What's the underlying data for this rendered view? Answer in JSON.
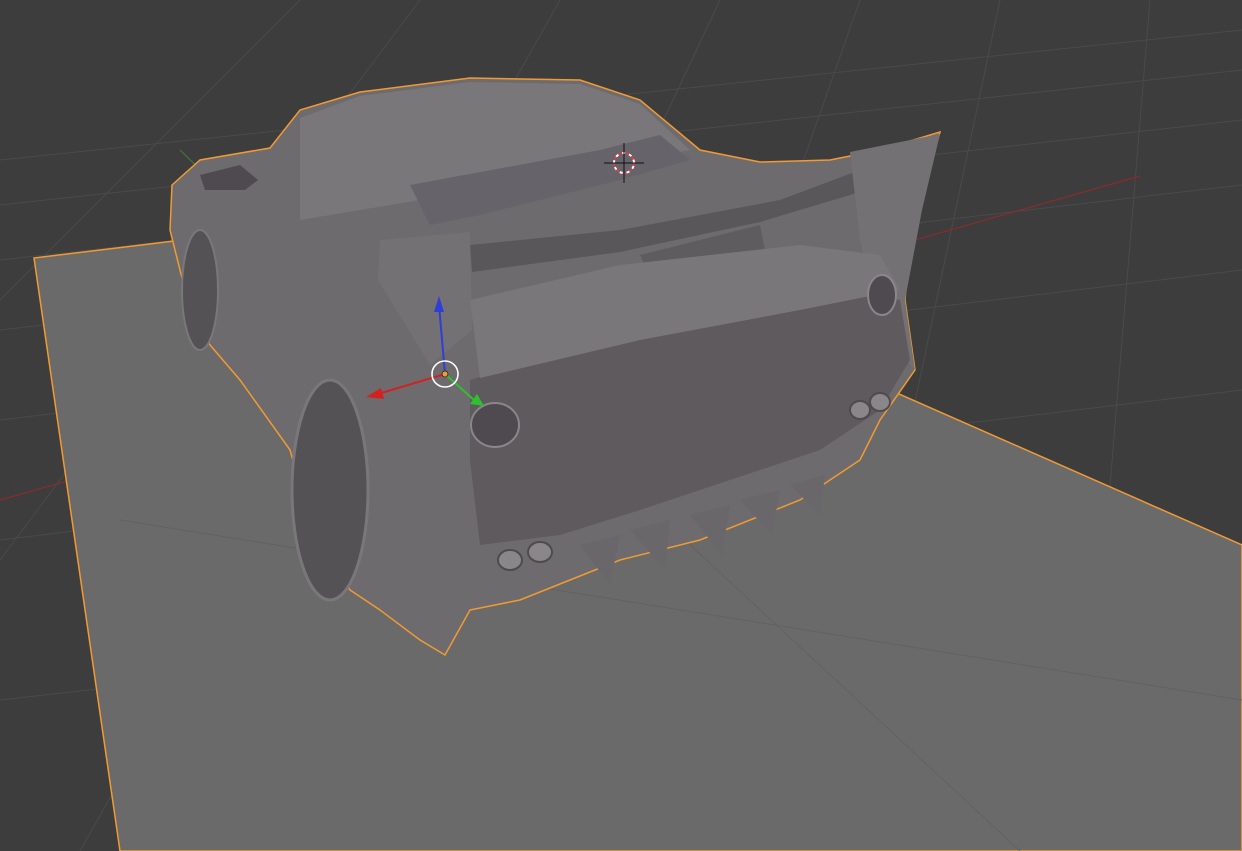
{
  "viewport": {
    "background": "#3d3d3d",
    "grid_color": "#4a4a4a",
    "x_axis_color": "#8a2b2b",
    "y_axis_color": "#3d7a3d",
    "selection_outline_color": "#f29a32",
    "plane_color": "#6a6a6a",
    "car_body_color": "#6e6b6e",
    "icons": [
      "3d-cursor-icon",
      "object-origin-icon",
      "translate-gizmo-icon"
    ]
  },
  "gizmo": {
    "x_axis_color": "#d42020",
    "y_axis_color": "#2fbf2f",
    "z_axis_color": "#2f3fd6",
    "origin_color": "#f29a32"
  },
  "cursor": {
    "ring_color_a": "#e23b3b",
    "ring_color_b": "#ffffff"
  }
}
